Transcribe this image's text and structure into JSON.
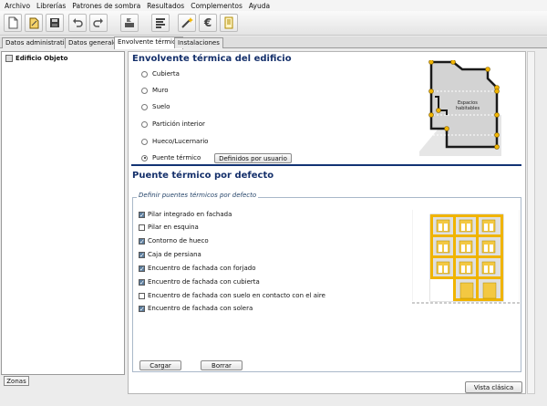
{
  "menubar": {
    "items": [
      "Archivo",
      "Librerías",
      "Patrones de sombra",
      "Resultados",
      "Complementos",
      "Ayuda"
    ]
  },
  "toolbar": {
    "icons": [
      "new-file-icon",
      "open-file-icon",
      "save-icon",
      "undo-icon",
      "redo-icon",
      "building-flag-icon",
      "bar-chart-icon",
      "magic-wand-icon",
      "euro-icon",
      "document-icon"
    ]
  },
  "tabs": [
    "Datos administrativos",
    "Datos generales",
    "Envolvente térmica",
    "Instalaciones"
  ],
  "sidebar": {
    "tree_root": "Edificio Objeto",
    "zonas_button": "Zonas"
  },
  "envolvente": {
    "title": "Envolvente térmica del edificio",
    "options": [
      "Cubierta",
      "Muro",
      "Suelo",
      "Partición interior",
      "Hueco/Lucernario",
      "Puente térmico"
    ],
    "selected": "Puente térmico",
    "user_defined_button": "Definidos por usuario",
    "diagram_label": "Espacios\nhabitables"
  },
  "puente": {
    "title": "Puente térmico por defecto",
    "group_label": "Definir puentes térmicos por defecto",
    "items": [
      {
        "label": "Pilar integrado en fachada",
        "checked": true
      },
      {
        "label": "Pilar en esquina",
        "checked": false
      },
      {
        "label": "Contorno de hueco",
        "checked": true
      },
      {
        "label": "Caja de persiana",
        "checked": true
      },
      {
        "label": "Encuentro de fachada con forjado",
        "checked": true
      },
      {
        "label": "Encuentro de fachada con cubierta",
        "checked": true
      },
      {
        "label": "Encuentro de fachada con suelo en contacto con el aire",
        "checked": false
      },
      {
        "label": "Encuentro de fachada con solera",
        "checked": true
      }
    ],
    "load_button": "Cargar",
    "delete_button": "Borrar"
  },
  "footer": {
    "vista_button": "Vista clásica"
  },
  "colors": {
    "title": "#15306b",
    "accent_yellow": "#f0b400"
  }
}
